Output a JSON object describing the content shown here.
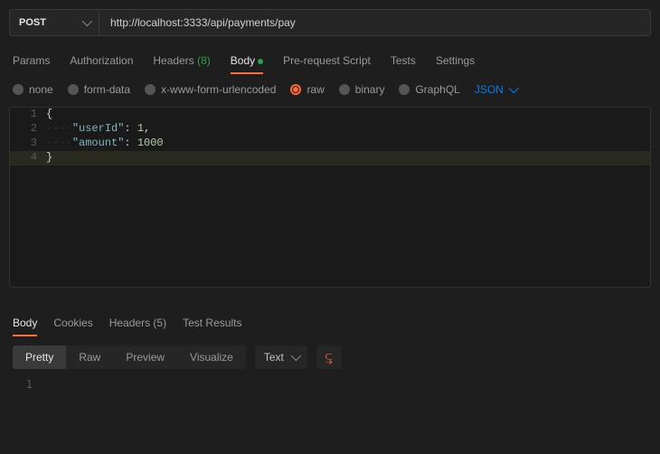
{
  "request": {
    "method": "POST",
    "url": "http://localhost:3333/api/payments/pay"
  },
  "request_tabs": [
    {
      "label": "Params"
    },
    {
      "label": "Authorization"
    },
    {
      "label": "Headers",
      "count": "(8)"
    },
    {
      "label": "Body",
      "active": true,
      "indicator": true
    },
    {
      "label": "Pre-request Script"
    },
    {
      "label": "Tests"
    },
    {
      "label": "Settings"
    }
  ],
  "body_types": {
    "none": "none",
    "formdata": "form-data",
    "urlenc": "x-www-form-urlencoded",
    "raw": "raw",
    "binary": "binary",
    "graphql": "GraphQL",
    "format": "JSON"
  },
  "editor": {
    "json_body": {
      "userId": 1,
      "amount": 1000
    },
    "lines": [
      {
        "n": "1",
        "brace": "{"
      },
      {
        "n": "2",
        "indent": "····",
        "key": "\"userId\"",
        "colon_sp": ": ",
        "val": "1",
        "comma": ","
      },
      {
        "n": "3",
        "indent": "····",
        "key": "\"amount\"",
        "colon_sp": ": ",
        "val": "1000",
        "comma": ""
      },
      {
        "n": "4",
        "brace": "}"
      }
    ]
  },
  "response_tabs": [
    {
      "label": "Body",
      "active": true
    },
    {
      "label": "Cookies"
    },
    {
      "label": "Headers",
      "count": "(5)"
    },
    {
      "label": "Test Results"
    }
  ],
  "response_view": {
    "pretty": "Pretty",
    "raw": "Raw",
    "preview": "Preview",
    "visualize": "Visualize",
    "type": "Text"
  },
  "response_lines": [
    {
      "n": "1",
      "text": ""
    }
  ]
}
